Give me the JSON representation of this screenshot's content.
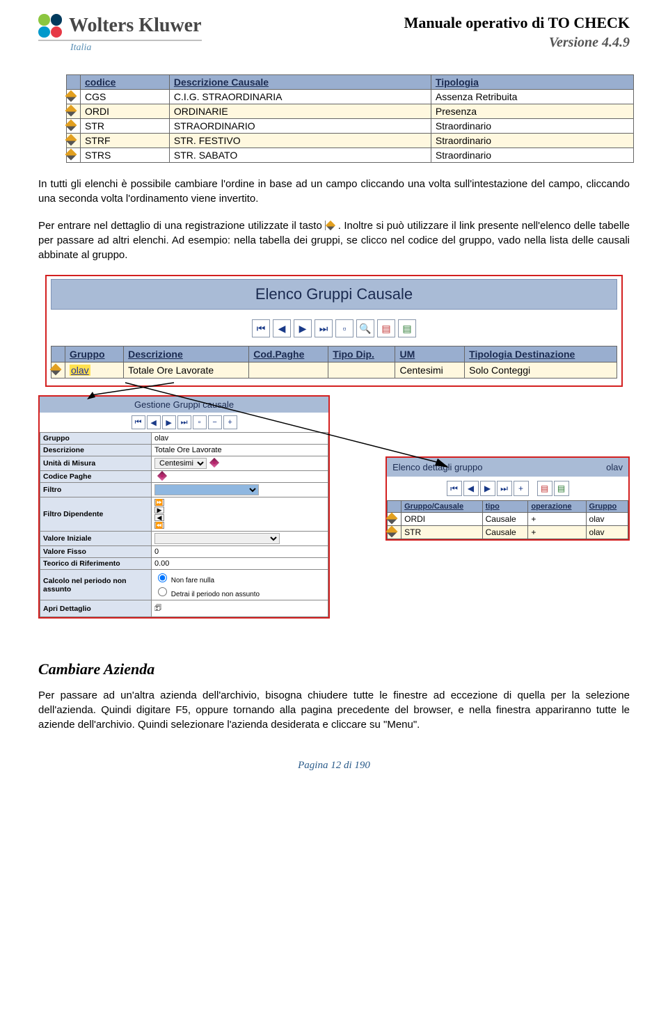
{
  "header": {
    "brand": "Wolters Kluwer",
    "sub": "Italia",
    "title": "Manuale operativo di  TO CHECK",
    "version": "Versione 4.4.9"
  },
  "table1": {
    "headers": [
      "codice",
      "Descrizione Causale",
      "Tipologia"
    ],
    "rows": [
      {
        "c": "CGS",
        "d": "C.I.G. STRAORDINARIA",
        "t": "Assenza Retribuita"
      },
      {
        "c": "ORDI",
        "d": "ORDINARIE",
        "t": "Presenza"
      },
      {
        "c": "STR",
        "d": "STRAORDINARIO",
        "t": "Straordinario"
      },
      {
        "c": "STRF",
        "d": "STR. FESTIVO",
        "t": "Straordinario"
      },
      {
        "c": "STRS",
        "d": "STR. SABATO",
        "t": "Straordinario"
      }
    ]
  },
  "para1": "In tutti gli elenchi è possibile cambiare l'ordine in base ad un campo cliccando una volta sull'intestazione del campo, cliccando una seconda volta l'ordinamento viene invertito.",
  "para2a": "Per entrare nel dettaglio di una registrazione utilizzate il tasto ",
  "para2b": ". Inoltre si può utilizzare il link presente nell'elenco delle tabelle per passare ad altri elenchi. Ad esempio: nella tabella dei gruppi, se clicco nel codice del gruppo, vado nella lista delle causali abbinate al gruppo.",
  "panel1": {
    "title": "Elenco Gruppi Causale",
    "headers": [
      "Gruppo",
      "Descrizione",
      "Cod.Paghe",
      "Tipo Dip.",
      "UM",
      "Tipologia Destinazione"
    ],
    "row": {
      "g": "olav",
      "d": "Totale Ore Lavorate",
      "cp": "",
      "td": "",
      "um": "Centesimi",
      "tdest": "Solo Conteggi"
    }
  },
  "form": {
    "title": "Gestione Gruppi causale",
    "fields": {
      "gruppo_l": "Gruppo",
      "gruppo_v": "olav",
      "descr_l": "Descrizione",
      "descr_v": "Totale Ore Lavorate",
      "um_l": "Unità di Misura",
      "um_v": "Centesimi",
      "cp_l": "Codice Paghe",
      "cp_v": "",
      "filtro_l": "Filtro",
      "filtrodip_l": "Filtro Dipendente",
      "vi_l": "Valore Iniziale",
      "vi_v": "",
      "vf_l": "Valore Fisso",
      "vf_v": "0",
      "tr_l": "Teorico di Riferimento",
      "tr_v": "0.00",
      "calc_l": "Calcolo nel periodo non assunto",
      "calc_o1": "Non fare nulla",
      "calc_o2": "Detrai il periodo non assunto",
      "apri_l": "Apri Dettaglio"
    }
  },
  "dett": {
    "title": "Elenco dettagli gruppo",
    "code": "olav",
    "headers": [
      "Gruppo/Causale",
      "tipo",
      "operazione",
      "Gruppo"
    ],
    "rows": [
      {
        "gc": "ORDI",
        "t": "Causale",
        "op": "+",
        "g": "olav"
      },
      {
        "gc": "STR",
        "t": "Causale",
        "op": "+",
        "g": "olav"
      }
    ]
  },
  "section": "Cambiare Azienda",
  "para3": "Per passare ad un'altra azienda dell'archivio, bisogna chiudere tutte le finestre ad eccezione di quella per la selezione dell'azienda. Quindi digitare F5, oppure tornando alla pagina precedente del browser, e nella finestra appariranno tutte le aziende dell'archivio. Quindi selezionare l'azienda desiderata e cliccare su \"Menu\".",
  "footer": "Pagina 12 di 190"
}
